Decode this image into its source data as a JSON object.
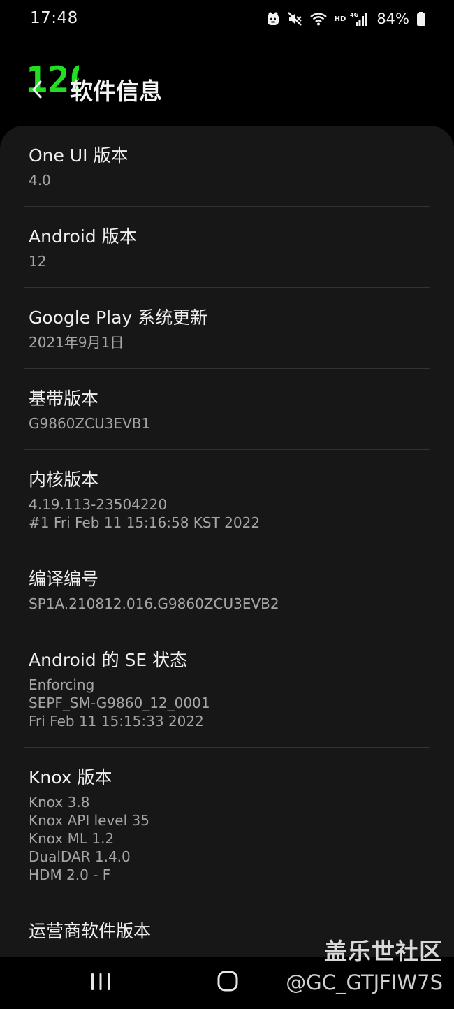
{
  "status_bar": {
    "time": "17:48",
    "icons": [
      "alarm-icon",
      "mute-icon",
      "wifi-icon",
      "hd-icon",
      "signal-4g-icon",
      "battery-icon"
    ],
    "hd_label": "HD",
    "network_label": "4G",
    "battery_percent": "84%"
  },
  "fps_badge": "120",
  "header": {
    "back_icon": "chevron-left-icon",
    "title": "软件信息"
  },
  "items": [
    {
      "title": "One UI 版本",
      "lines": [
        "4.0"
      ]
    },
    {
      "title": "Android 版本",
      "lines": [
        "12"
      ]
    },
    {
      "title": "Google Play 系统更新",
      "lines": [
        "2021年9月1日"
      ]
    },
    {
      "title": "基带版本",
      "lines": [
        "G9860ZCU3EVB1"
      ]
    },
    {
      "title": "内核版本",
      "lines": [
        "4.19.113-23504220",
        "#1 Fri Feb 11 15:16:58 KST 2022"
      ]
    },
    {
      "title": "编译编号",
      "lines": [
        "SP1A.210812.016.G9860ZCU3EVB2"
      ]
    },
    {
      "title": "Android 的 SE 状态",
      "lines": [
        "Enforcing",
        "SEPF_SM-G9860_12_0001",
        "Fri Feb 11 15:15:33 2022"
      ]
    },
    {
      "title": "Knox 版本",
      "lines": [
        "Knox 3.8",
        "Knox API level 35",
        "Knox ML 1.2",
        "DualDAR 1.4.0",
        "HDM 2.0 - F"
      ]
    },
    {
      "title": "运营商软件版本",
      "lines": []
    }
  ],
  "watermark": {
    "site": "盖乐世社区",
    "handle": "@GC_GTJFIW7S"
  },
  "nav": {
    "recents_icon": "recents-icon",
    "home_icon": "home-icon"
  },
  "colors": {
    "background": "#000000",
    "card": "#171717",
    "divider": "#333333",
    "title_text": "#f0f0f0",
    "secondary_text": "#a6a6a6",
    "fps_badge": "#22dd22"
  }
}
